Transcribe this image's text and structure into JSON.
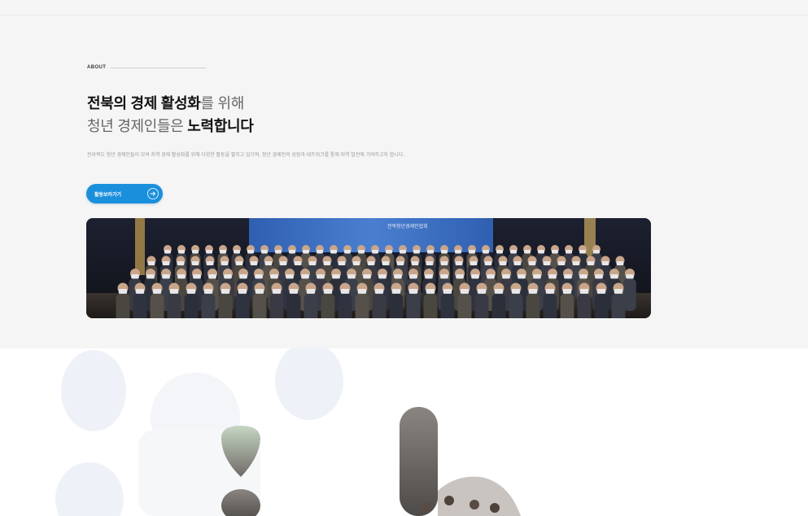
{
  "about": {
    "eyebrow": "ABOUT",
    "headline_line1_strong": "전북의 경제 활성화",
    "headline_line1_light": "를 위해",
    "headline_line2_light": "청년 경제인들은 ",
    "headline_line2_strong": "노력합니다",
    "description": "전라북도 청년 경제인들이 모여 지역 경제 활성화를 위해 다양한 활동을 펼치고 있으며, 청년 경제인의 성장과 네트워크를 통해 지역 발전에 기여하고자 합니다.",
    "cta_label": "활동보러가기",
    "photo_banner_text": "전북청년경제인협회"
  },
  "colors": {
    "accent": "#1a8fdc",
    "top_band": "#f5f5f5"
  },
  "icons": {
    "cta_icon": "arrow-right-icon"
  }
}
